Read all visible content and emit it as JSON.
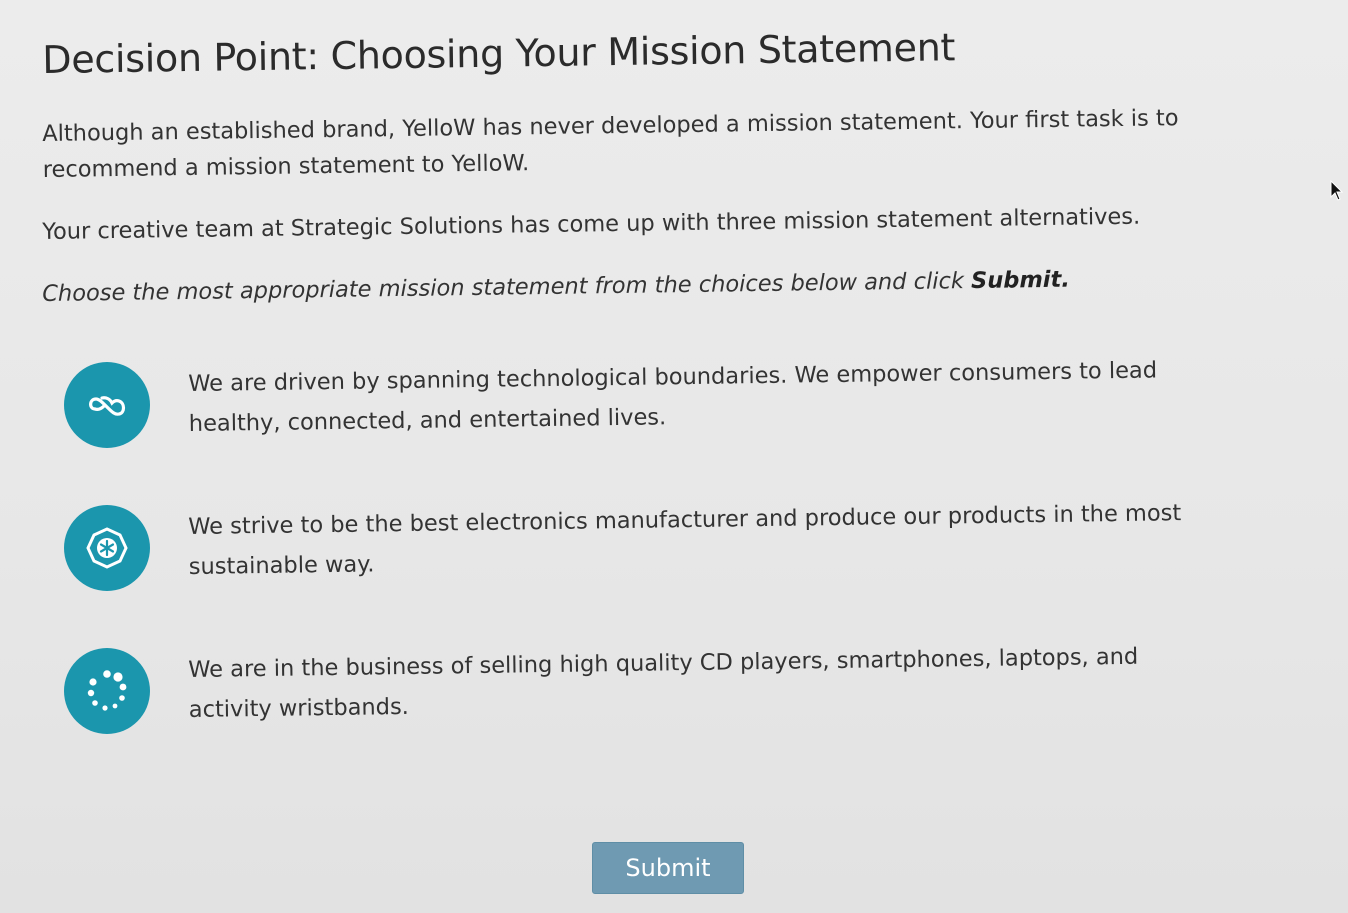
{
  "page": {
    "title": "Decision Point: Choosing Your Mission Statement",
    "intro_paragraph": "Although an established brand, YelloW has never developed a mission statement. Your first task is to recommend a mission statement to YelloW.",
    "team_paragraph": "Your creative team at Strategic Solutions has come up with three mission statement alternatives.",
    "instruction_prefix": "Choose the most appropriate mission statement from the choices below and click ",
    "instruction_bold": "Submit."
  },
  "options": [
    {
      "icon": "infinity-cloud-icon",
      "text": "We are driven by spanning technological boundaries. We empower consumers to lead healthy, connected, and entertained lives."
    },
    {
      "icon": "snowflake-badge-icon",
      "text": "We strive to be the best electronics manufacturer and produce our products in the most sustainable way."
    },
    {
      "icon": "dotted-ring-icon",
      "text": "We are in the business of selling high quality CD players, smartphones, laptops, and activity wristbands."
    }
  ],
  "submit": {
    "label": "Submit"
  },
  "colors": {
    "accent": "#1b96ad",
    "submit_bg": "#6f9ab2",
    "background": "#ececec",
    "text": "#333333"
  }
}
